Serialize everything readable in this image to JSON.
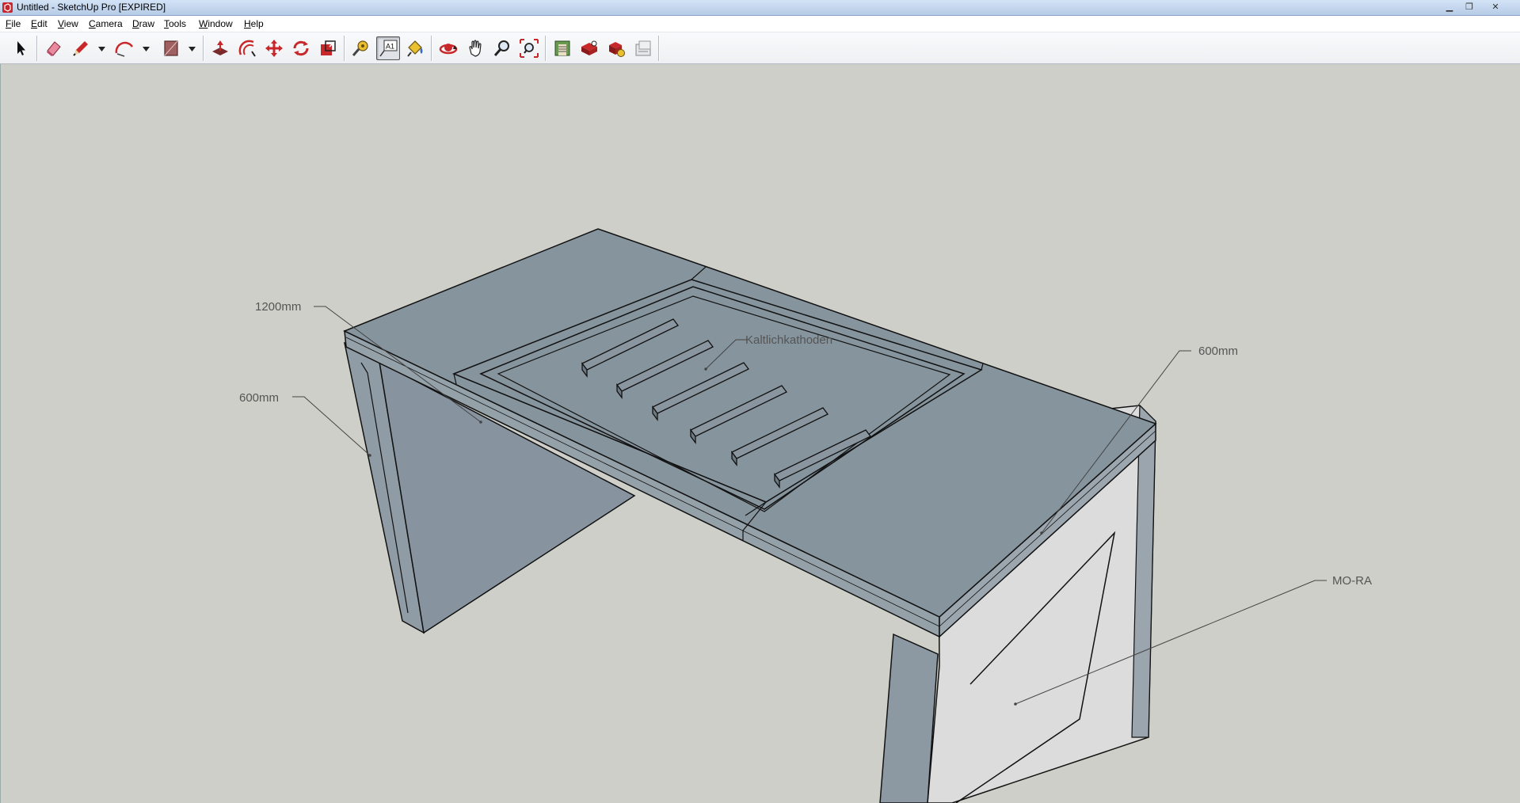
{
  "window": {
    "title": "Untitled - SketchUp Pro [EXPIRED]",
    "controls": {
      "minimize": "▁",
      "maximize": "❐",
      "close": "✕"
    }
  },
  "menu": {
    "file": {
      "mnemonic": "F",
      "rest": "ile"
    },
    "edit": {
      "mnemonic": "E",
      "rest": "dit"
    },
    "view": {
      "mnemonic": "V",
      "rest": "iew"
    },
    "camera": {
      "mnemonic": "C",
      "rest": "amera"
    },
    "draw": {
      "mnemonic": "D",
      "rest": "raw"
    },
    "tools": {
      "mnemonic": "T",
      "rest": "ools"
    },
    "window": {
      "mnemonic": "W",
      "rest": "indow"
    },
    "help": {
      "mnemonic": "H",
      "rest": "elp"
    }
  },
  "toolbar": {
    "tools": [
      {
        "name": "select-tool",
        "icon": "arrow-icon"
      },
      {
        "name": "eraser-tool",
        "icon": "eraser-icon"
      },
      {
        "name": "line-tool",
        "icon": "pencil-icon"
      },
      {
        "name": "arc-tool",
        "icon": "arc-icon"
      },
      {
        "name": "rectangle-tool",
        "icon": "rectangle-icon"
      },
      {
        "name": "push-pull-tool",
        "icon": "push-pull-icon"
      },
      {
        "name": "offset-tool",
        "icon": "offset-icon"
      },
      {
        "name": "move-tool",
        "icon": "move-icon"
      },
      {
        "name": "rotate-tool",
        "icon": "rotate-icon"
      },
      {
        "name": "scale-tool",
        "icon": "scale-icon"
      },
      {
        "name": "tape-measure-tool",
        "icon": "tape-measure-icon"
      },
      {
        "name": "text-tool",
        "icon": "text-icon",
        "label": "A1",
        "active": true
      },
      {
        "name": "paint-bucket-tool",
        "icon": "paint-bucket-icon"
      },
      {
        "name": "orbit-tool",
        "icon": "orbit-icon"
      },
      {
        "name": "pan-tool",
        "icon": "hand-icon"
      },
      {
        "name": "zoom-tool",
        "icon": "magnifier-icon"
      },
      {
        "name": "zoom-extents-tool",
        "icon": "zoom-extents-icon"
      },
      {
        "name": "warehouse-tool",
        "icon": "warehouse-icon"
      },
      {
        "name": "share-model-tool",
        "icon": "share-model-icon"
      },
      {
        "name": "components-tool",
        "icon": "components-icon"
      },
      {
        "name": "layout-tool",
        "icon": "layout-icon"
      }
    ],
    "colors": {
      "red": "#c8282a",
      "dark": "#333333"
    }
  },
  "canvas": {
    "background": "#cfcfc9",
    "model_color": "#86949d",
    "model_side": "#8c99a2",
    "model_light_side": "#dcdcdc",
    "labels": {
      "dim_left_top": "1200mm",
      "dim_left_mid": "600mm",
      "dim_right": "600mm",
      "note_center": "Kaltlichkathoden",
      "note_right": "MO-RA"
    }
  }
}
